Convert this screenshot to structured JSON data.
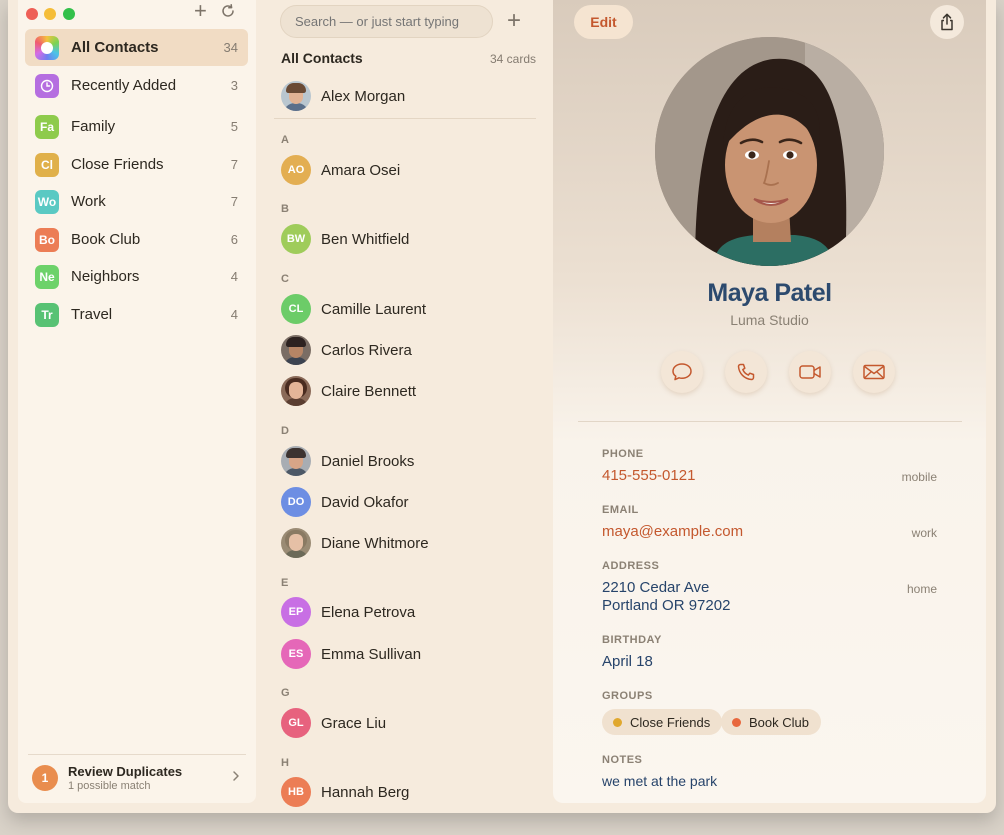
{
  "sidebar": {
    "items": [
      {
        "label": "All Contacts",
        "count": "34",
        "icon": "rainbow-ring-icon",
        "selected": true
      },
      {
        "label": "Recently Added",
        "count": "3",
        "icon": "clock-icon",
        "color": "#b56ee0"
      },
      {
        "label": "Family",
        "count": "5",
        "icon_text": "Fa",
        "color": "#8ecb4c"
      },
      {
        "label": "Close Friends",
        "count": "7",
        "icon_text": "Cl",
        "color": "#e0b04a"
      },
      {
        "label": "Work",
        "count": "7",
        "icon_text": "Wo",
        "color": "#5ac9c3"
      },
      {
        "label": "Book Club",
        "count": "6",
        "icon_text": "Bo",
        "color": "#ec7d55"
      },
      {
        "label": "Neighbors",
        "count": "4",
        "icon_text": "Ne",
        "color": "#6dd26a"
      },
      {
        "label": "Travel",
        "count": "4",
        "icon_text": "Tr",
        "color": "#58c274"
      }
    ],
    "footer": {
      "badge": "1",
      "title": "Review Duplicates",
      "subtitle": "1 possible match"
    }
  },
  "list": {
    "search_placeholder": "Search — or just start typing",
    "heading": "All Contacts",
    "count": "34 cards",
    "me": {
      "name": "Alex Morgan"
    },
    "sections": [
      {
        "letter": "A",
        "contacts": [
          {
            "name": "Amara Osei",
            "initials": "AO",
            "color": "#e3ae52"
          }
        ]
      },
      {
        "letter": "B",
        "contacts": [
          {
            "name": "Ben Whitfield",
            "initials": "BW",
            "color": "#9fcc5a"
          }
        ]
      },
      {
        "letter": "C",
        "contacts": [
          {
            "name": "Camille Laurent",
            "initials": "CL",
            "color": "#6ccc68"
          },
          {
            "name": "Carlos Rivera",
            "photo": true
          },
          {
            "name": "Claire Bennett",
            "photo": true
          }
        ]
      },
      {
        "letter": "D",
        "contacts": [
          {
            "name": "Daniel Brooks",
            "photo": true
          },
          {
            "name": "David Okafor",
            "initials": "DO",
            "color": "#6d8ee3"
          },
          {
            "name": "Diane Whitmore",
            "photo": true
          }
        ]
      },
      {
        "letter": "E",
        "contacts": [
          {
            "name": "Elena Petrova",
            "initials": "EP",
            "color": "#c86fe4"
          },
          {
            "name": "Emma Sullivan",
            "initials": "ES",
            "color": "#e567b8"
          }
        ]
      },
      {
        "letter": "G",
        "contacts": [
          {
            "name": "Grace Liu",
            "initials": "GL",
            "color": "#e7627e"
          }
        ]
      },
      {
        "letter": "H",
        "contacts": [
          {
            "name": "Hannah Berg",
            "initials": "HB",
            "color": "#ec7d55"
          }
        ]
      }
    ]
  },
  "detail": {
    "edit_label": "Edit",
    "name": "Maya Patel",
    "company": "Luma Studio",
    "actions": [
      "message-icon",
      "phone-icon",
      "video-icon",
      "mail-icon"
    ],
    "phone_label": "PHONE",
    "phone": "415-555-0121",
    "phone_tag": "mobile",
    "email_label": "EMAIL",
    "email": "maya@example.com",
    "email_tag": "work",
    "address_label": "ADDRESS",
    "address_line1": "2210 Cedar Ave",
    "address_line2": "Portland OR 97202",
    "address_tag": "home",
    "birthday_label": "BIRTHDAY",
    "birthday": "April 18",
    "groups_label": "GROUPS",
    "groups": [
      {
        "label": "Close Friends",
        "color": "#e0a82e"
      },
      {
        "label": "Book Club",
        "color": "#e8683e"
      }
    ],
    "notes_label": "NOTES",
    "notes": "we met at the park"
  }
}
